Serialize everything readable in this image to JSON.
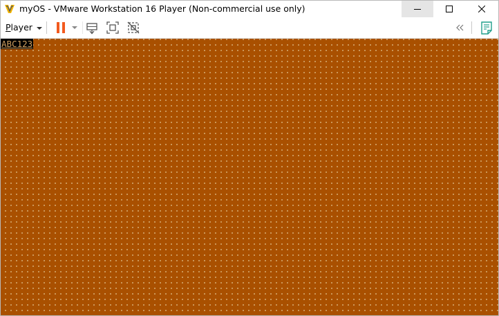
{
  "window": {
    "title": "myOS - VMware Workstation 16 Player (Non-commercial use only)"
  },
  "window_controls": {
    "minimize": "minimize-icon",
    "maximize": "maximize-icon",
    "close": "close-icon"
  },
  "toolbar": {
    "player_menu_label_prefix": "P",
    "player_menu_label_rest": "layer",
    "icons": [
      "pause-icon",
      "dropdown-caret-icon",
      "send-ctrl-alt-del-icon",
      "fullscreen-icon",
      "unity-icon",
      "collapse-icon",
      "notes-icon"
    ]
  },
  "guest": {
    "background_color": "#a95000",
    "text_line": "ABC123"
  }
}
